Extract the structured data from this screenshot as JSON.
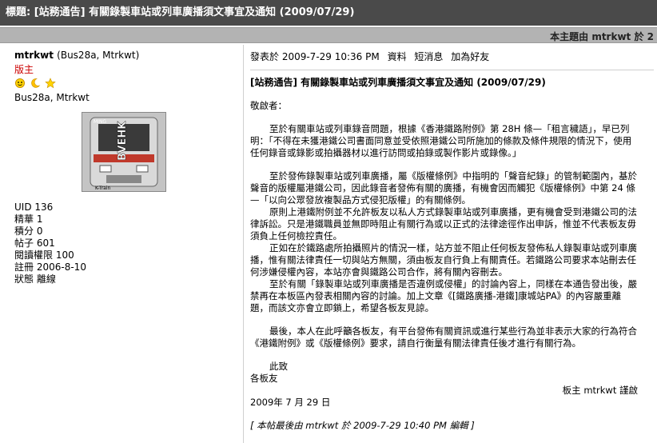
{
  "titlebar": {
    "title": "標題: [站務通告] 有關錄製車站或列車廣播須文事宜及通知 (2009/07/29)"
  },
  "subbar": {
    "text": "本主題由 mtrkwt 於 2"
  },
  "author": {
    "name": "mtrkwt",
    "nick": "(Bus28a, Mtrkwt)",
    "role": "版主",
    "names2": "Bus28a, Mtrkwt",
    "avatar_text": {
      "vertical": "BVEHK",
      "top": "MING",
      "bottom": "K-Train"
    },
    "stats": [
      {
        "label": "UID",
        "value": "136"
      },
      {
        "label": "精華",
        "value": "1"
      },
      {
        "label": "積分",
        "value": "0"
      },
      {
        "label": "帖子",
        "value": "601"
      },
      {
        "label": "閱讀權限",
        "value": "100"
      },
      {
        "label": "註冊",
        "value": "2006-8-10"
      },
      {
        "label": "狀態",
        "value": "離線"
      }
    ]
  },
  "post": {
    "meta": "發表於 2009-7-29 10:36 PM",
    "links": [
      "資料",
      "短消息",
      "加為好友"
    ],
    "title": "[站務通告] 有關錄製車站或列車廣播須文事宜及通知 (2009/07/29)",
    "greeting": "敬啟者：",
    "p1": "至於有關車站或列車錄音問題，根據《香港鐵路附例》第 28H 條—「租言穢語」，早已列明：「不得在未獲港鐵公司書面同意並受依照港鐵公司所施加的條款及條件規限的情況下，使用任何錄音或錄影或拍攝器材以進行訪問或拍錄或製作影片或錄像。」",
    "p2": "至於發佈錄製車站或列車廣播，屬《版權條例》中指明的「聲音紀錄」的管制範圍內，基於聲音的版權屬港鐵公司，因此錄音者發佈有關的廣播，有機會因而觸犯《版權條例》中第 24 條—「以向公眾發放複製品方式侵犯版權」的有關條例。",
    "p3": "原則上港鐵附例並不允許板友以私人方式錄製車站或列車廣播，更有機會受到港鐵公司的法律訴訟。只是港鐵職員並無即時阻止有關行為或以正式的法律途徑作出申訴，惟並不代表板友毋須負上任何檢控責任。",
    "p4": "正如在於鐵路處所拍攝照片的情況一樣，站方並不阻止任何板友發佈私人錄製車站或列車廣播，惟有關法律責任一切與站方無關，須由板友自行負上有關責任。若鐵路公司要求本站刪去任何涉嫌侵權內容，本站亦會與鐵路公司合作，將有關內容刪去。",
    "p5": "至於有關「錄製車站或列車廣播是否違例或侵權」的討論內容上，同樣在本通告發出後，嚴禁再在本板區內發表相關內容的討論。加上文章《[鐵路廣播-港鐵]康城站PA》的內容嚴重離題，而該文亦會立即鎖上，希望各板友見諒。",
    "p6": "最後，本人在此呼籲各板友，有平台發佈有關資訊或進行某些行為並非表示大家的行為符合《港鐵附例》或《版權條例》要求，請自行衡量有關法律責任後才進行有關行為。",
    "closing1": "此致",
    "closing2": "各板友",
    "sign": "板主 mtrkwt 謹啟",
    "date": "2009年 7 月 29 日",
    "edit": "[ 本帖最後由 mtrkwt 於 2009-7-29 10:40 PM 編輯 ]"
  }
}
